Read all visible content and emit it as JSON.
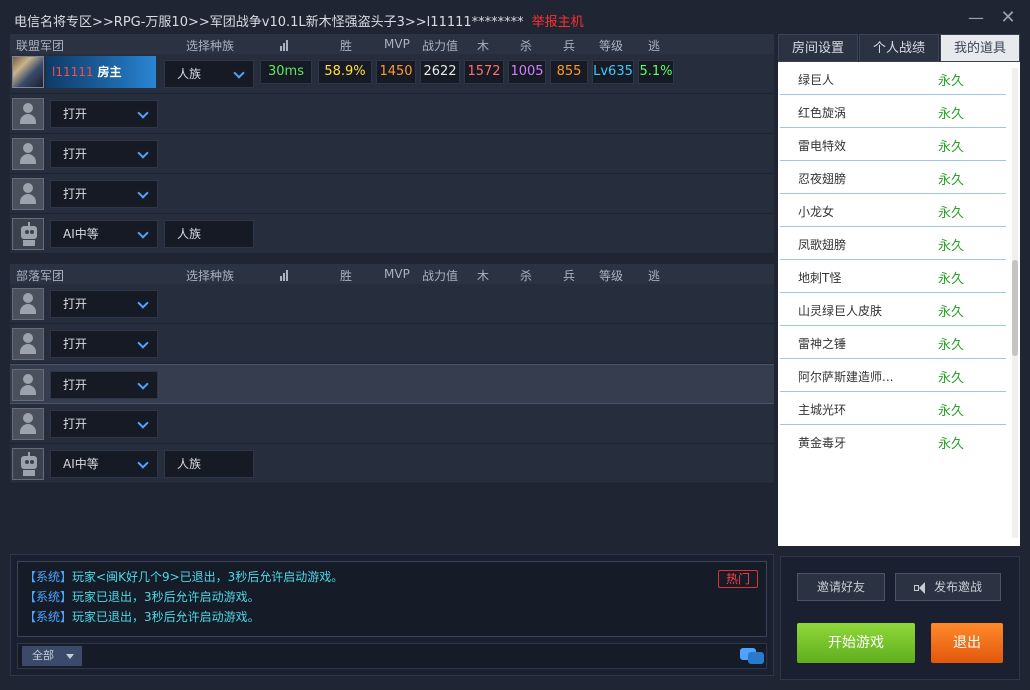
{
  "title": {
    "breadcrumb": "电信名将专区>>RPG-万服10>>军团战争v10.1L新木怪强盗头子3>>l11111********",
    "report": "举报主机"
  },
  "alliance": {
    "team_name": "联盟军团",
    "col_race": "选择种族",
    "col_win": "胜",
    "col_mvp": "MVP",
    "col_power": "战力值",
    "col_wood": "木",
    "col_kill": "杀",
    "col_soldier": "兵",
    "col_level": "等级",
    "col_escape": "逃",
    "host": {
      "name": "l11111",
      "badge": "房主",
      "race": "人族",
      "ping": "30ms",
      "win_rate": "58.9%",
      "mvp": "1450",
      "power": "2622",
      "wood": "1572",
      "kill": "1005",
      "soldier": "855",
      "level": "Lv635",
      "escape": "5.1%"
    },
    "slots": [
      {
        "state": "打开"
      },
      {
        "state": "打开"
      },
      {
        "state": "打开"
      }
    ],
    "ai": {
      "difficulty": "AI中等",
      "race": "人族"
    }
  },
  "horde": {
    "team_name": "部落军团",
    "col_race": "选择种族",
    "col_win": "胜",
    "col_mvp": "MVP",
    "col_power": "战力值",
    "col_wood": "木",
    "col_kill": "杀",
    "col_soldier": "兵",
    "col_level": "等级",
    "col_escape": "逃",
    "slots": [
      {
        "state": "打开"
      },
      {
        "state": "打开"
      },
      {
        "state": "打开"
      },
      {
        "state": "打开"
      }
    ],
    "ai": {
      "difficulty": "AI中等",
      "race": "人族"
    }
  },
  "side": {
    "tabs": [
      "房间设置",
      "个人战绩",
      "我的道具"
    ],
    "active_tab": "我的道具",
    "items": [
      {
        "name": "绿巨人",
        "duration": "永久"
      },
      {
        "name": "红色旋涡",
        "duration": "永久"
      },
      {
        "name": "雷电特效",
        "duration": "永久"
      },
      {
        "name": "忍夜翅膀",
        "duration": "永久"
      },
      {
        "name": "小龙女",
        "duration": "永久"
      },
      {
        "name": "凤歌翅膀",
        "duration": "永久"
      },
      {
        "name": "地刺T怪",
        "duration": "永久"
      },
      {
        "name": "山灵绿巨人皮肤",
        "duration": "永久"
      },
      {
        "name": "雷神之锤",
        "duration": "永久"
      },
      {
        "name": "阿尔萨斯建造师...",
        "duration": "永久"
      },
      {
        "name": "主城光环",
        "duration": "永久"
      },
      {
        "name": "黄金毒牙",
        "duration": "永久"
      }
    ]
  },
  "chat": {
    "messages": [
      {
        "tag": "【系统】",
        "text": "玩家<闽K好几个9>已退出，3秒后允许启动游戏。"
      },
      {
        "tag": "【系统】",
        "text": "玩家已退出，3秒后允许启动游戏。"
      },
      {
        "tag": "【系统】",
        "text": "玩家已退出，3秒后允许启动游戏。"
      }
    ],
    "hot_label": "热门",
    "scope": "全部"
  },
  "actions": {
    "invite": "邀请好友",
    "publish": "发布邀战",
    "start": "开始游戏",
    "exit": "退出"
  },
  "colors": {
    "win": "#ffe040",
    "mvp": "#ff9a2a",
    "power": "#e8e8e8",
    "wood": "#ff7070",
    "kill": "#d080ff",
    "soldier": "#ff9a2a",
    "level": "#40c8ff",
    "escape": "#60ff60",
    "ping": "#5fe85f"
  }
}
